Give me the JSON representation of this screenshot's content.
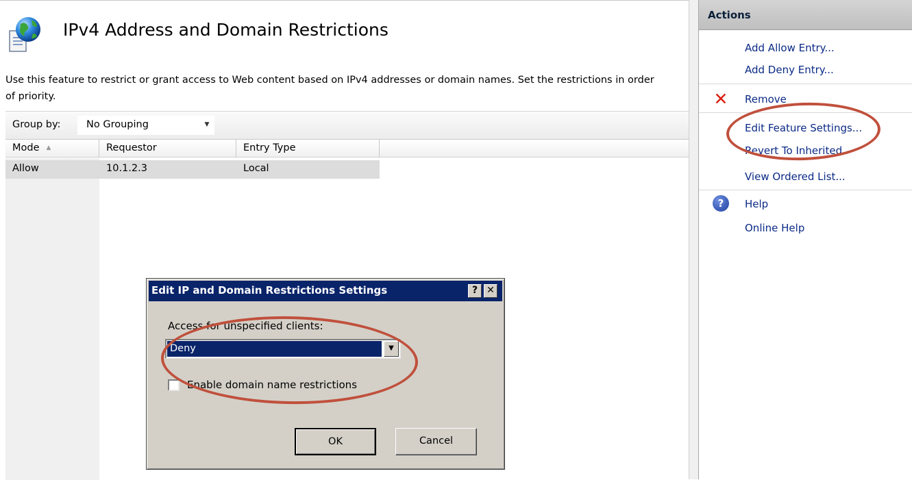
{
  "feature": {
    "title": "IPv4 Address and Domain Restrictions",
    "description": "Use this feature to restrict or grant access to Web content based on IPv4 addresses or domain names. Set the restrictions in order of priority.",
    "icon": "globe-document-icon"
  },
  "group_by": {
    "label": "Group by:",
    "value": "No Grouping"
  },
  "list": {
    "columns": [
      "Mode",
      "Requestor",
      "Entry Type"
    ],
    "sort_column": "Mode",
    "rows": [
      {
        "mode": "Allow",
        "requestor": "10.1.2.3",
        "entry_type": "Local"
      }
    ]
  },
  "actions": {
    "title": "Actions",
    "items": [
      {
        "label": "Add Allow Entry..."
      },
      {
        "label": "Add Deny Entry..."
      },
      {
        "label": "Remove",
        "icon": "red-x-icon"
      },
      {
        "label": "Edit Feature Settings..."
      },
      {
        "label": "Revert To Inherited"
      },
      {
        "label": "View Ordered List..."
      },
      {
        "label": "Help",
        "icon": "help-icon"
      },
      {
        "label": "Online Help"
      }
    ]
  },
  "dialog": {
    "title": "Edit IP and Domain Restrictions Settings",
    "help_glyph": "?",
    "close_glyph": "✕",
    "access_label": "Access for unspecified clients:",
    "access_value": "Deny",
    "domain_checkbox_label": "Enable domain name restrictions",
    "domain_checkbox_checked": false,
    "ok_label": "OK",
    "cancel_label": "Cancel"
  },
  "annotation_color": "#c0503c",
  "selection_color": "#0a246a"
}
